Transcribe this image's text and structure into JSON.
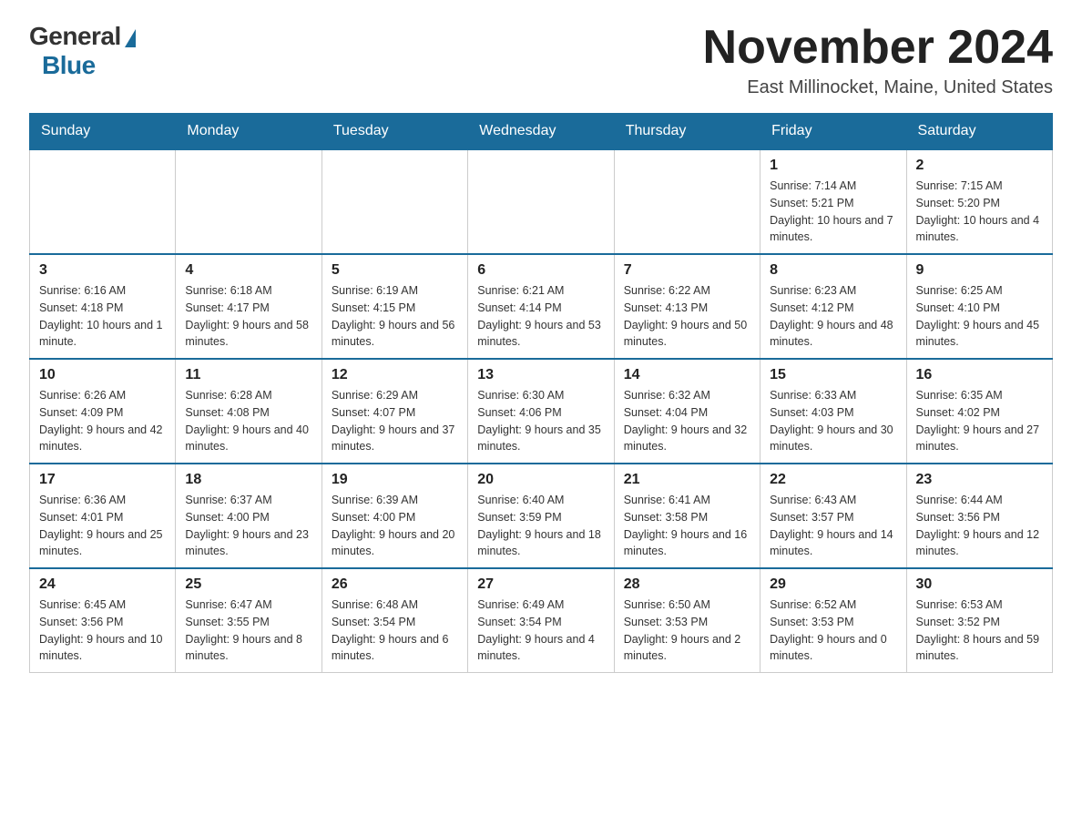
{
  "header": {
    "logo_general": "General",
    "logo_blue": "Blue",
    "month_title": "November 2024",
    "location": "East Millinocket, Maine, United States"
  },
  "weekdays": [
    "Sunday",
    "Monday",
    "Tuesday",
    "Wednesday",
    "Thursday",
    "Friday",
    "Saturday"
  ],
  "weeks": [
    [
      {
        "day": "",
        "info": ""
      },
      {
        "day": "",
        "info": ""
      },
      {
        "day": "",
        "info": ""
      },
      {
        "day": "",
        "info": ""
      },
      {
        "day": "",
        "info": ""
      },
      {
        "day": "1",
        "info": "Sunrise: 7:14 AM\nSunset: 5:21 PM\nDaylight: 10 hours and 7 minutes."
      },
      {
        "day": "2",
        "info": "Sunrise: 7:15 AM\nSunset: 5:20 PM\nDaylight: 10 hours and 4 minutes."
      }
    ],
    [
      {
        "day": "3",
        "info": "Sunrise: 6:16 AM\nSunset: 4:18 PM\nDaylight: 10 hours and 1 minute."
      },
      {
        "day": "4",
        "info": "Sunrise: 6:18 AM\nSunset: 4:17 PM\nDaylight: 9 hours and 58 minutes."
      },
      {
        "day": "5",
        "info": "Sunrise: 6:19 AM\nSunset: 4:15 PM\nDaylight: 9 hours and 56 minutes."
      },
      {
        "day": "6",
        "info": "Sunrise: 6:21 AM\nSunset: 4:14 PM\nDaylight: 9 hours and 53 minutes."
      },
      {
        "day": "7",
        "info": "Sunrise: 6:22 AM\nSunset: 4:13 PM\nDaylight: 9 hours and 50 minutes."
      },
      {
        "day": "8",
        "info": "Sunrise: 6:23 AM\nSunset: 4:12 PM\nDaylight: 9 hours and 48 minutes."
      },
      {
        "day": "9",
        "info": "Sunrise: 6:25 AM\nSunset: 4:10 PM\nDaylight: 9 hours and 45 minutes."
      }
    ],
    [
      {
        "day": "10",
        "info": "Sunrise: 6:26 AM\nSunset: 4:09 PM\nDaylight: 9 hours and 42 minutes."
      },
      {
        "day": "11",
        "info": "Sunrise: 6:28 AM\nSunset: 4:08 PM\nDaylight: 9 hours and 40 minutes."
      },
      {
        "day": "12",
        "info": "Sunrise: 6:29 AM\nSunset: 4:07 PM\nDaylight: 9 hours and 37 minutes."
      },
      {
        "day": "13",
        "info": "Sunrise: 6:30 AM\nSunset: 4:06 PM\nDaylight: 9 hours and 35 minutes."
      },
      {
        "day": "14",
        "info": "Sunrise: 6:32 AM\nSunset: 4:04 PM\nDaylight: 9 hours and 32 minutes."
      },
      {
        "day": "15",
        "info": "Sunrise: 6:33 AM\nSunset: 4:03 PM\nDaylight: 9 hours and 30 minutes."
      },
      {
        "day": "16",
        "info": "Sunrise: 6:35 AM\nSunset: 4:02 PM\nDaylight: 9 hours and 27 minutes."
      }
    ],
    [
      {
        "day": "17",
        "info": "Sunrise: 6:36 AM\nSunset: 4:01 PM\nDaylight: 9 hours and 25 minutes."
      },
      {
        "day": "18",
        "info": "Sunrise: 6:37 AM\nSunset: 4:00 PM\nDaylight: 9 hours and 23 minutes."
      },
      {
        "day": "19",
        "info": "Sunrise: 6:39 AM\nSunset: 4:00 PM\nDaylight: 9 hours and 20 minutes."
      },
      {
        "day": "20",
        "info": "Sunrise: 6:40 AM\nSunset: 3:59 PM\nDaylight: 9 hours and 18 minutes."
      },
      {
        "day": "21",
        "info": "Sunrise: 6:41 AM\nSunset: 3:58 PM\nDaylight: 9 hours and 16 minutes."
      },
      {
        "day": "22",
        "info": "Sunrise: 6:43 AM\nSunset: 3:57 PM\nDaylight: 9 hours and 14 minutes."
      },
      {
        "day": "23",
        "info": "Sunrise: 6:44 AM\nSunset: 3:56 PM\nDaylight: 9 hours and 12 minutes."
      }
    ],
    [
      {
        "day": "24",
        "info": "Sunrise: 6:45 AM\nSunset: 3:56 PM\nDaylight: 9 hours and 10 minutes."
      },
      {
        "day": "25",
        "info": "Sunrise: 6:47 AM\nSunset: 3:55 PM\nDaylight: 9 hours and 8 minutes."
      },
      {
        "day": "26",
        "info": "Sunrise: 6:48 AM\nSunset: 3:54 PM\nDaylight: 9 hours and 6 minutes."
      },
      {
        "day": "27",
        "info": "Sunrise: 6:49 AM\nSunset: 3:54 PM\nDaylight: 9 hours and 4 minutes."
      },
      {
        "day": "28",
        "info": "Sunrise: 6:50 AM\nSunset: 3:53 PM\nDaylight: 9 hours and 2 minutes."
      },
      {
        "day": "29",
        "info": "Sunrise: 6:52 AM\nSunset: 3:53 PM\nDaylight: 9 hours and 0 minutes."
      },
      {
        "day": "30",
        "info": "Sunrise: 6:53 AM\nSunset: 3:52 PM\nDaylight: 8 hours and 59 minutes."
      }
    ]
  ]
}
